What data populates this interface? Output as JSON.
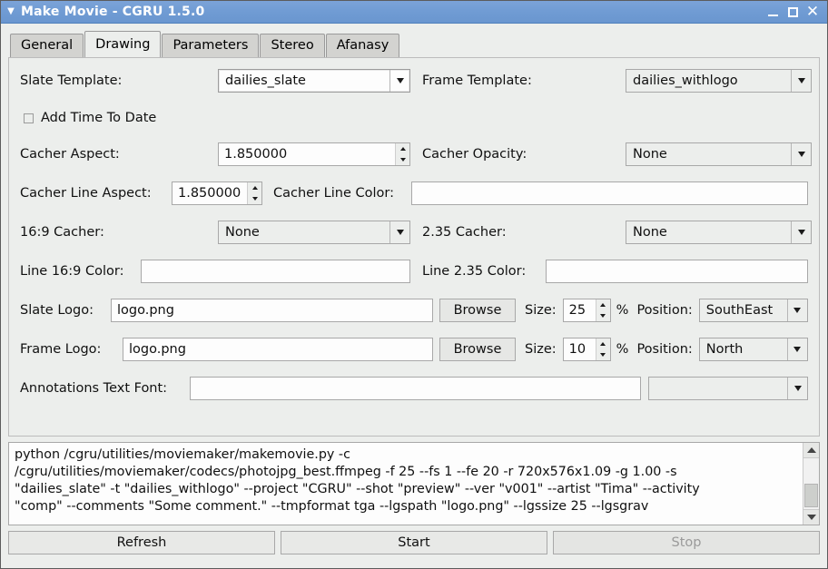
{
  "window": {
    "title": "Make Movie - CGRU 1.5.0",
    "menu_icon": "caret-down-icon",
    "minimize_label": "–",
    "maximize_label": "□",
    "close_label": "✕"
  },
  "tabs": [
    {
      "label": "General",
      "active": false
    },
    {
      "label": "Drawing",
      "active": true
    },
    {
      "label": "Parameters",
      "active": false
    },
    {
      "label": "Stereo",
      "active": false
    },
    {
      "label": "Afanasy",
      "active": false
    }
  ],
  "form": {
    "slate_template": {
      "label": "Slate Template:",
      "value": "dailies_slate"
    },
    "frame_template": {
      "label": "Frame Template:",
      "value": "dailies_withlogo"
    },
    "add_time_to_date": {
      "label": "Add Time To Date",
      "checked": false
    },
    "cacher_aspect": {
      "label": "Cacher Aspect:",
      "value": "1.850000"
    },
    "cacher_opacity": {
      "label": "Cacher Opacity:",
      "value": "None"
    },
    "cacher_line_aspect": {
      "label": "Cacher Line Aspect:",
      "value": "1.850000"
    },
    "cacher_line_color": {
      "label": "Cacher Line Color:",
      "value": ""
    },
    "cacher_169": {
      "label": "16:9 Cacher:",
      "value": "None"
    },
    "cacher_235": {
      "label": "2.35 Cacher:",
      "value": "None"
    },
    "line_169_color": {
      "label": "Line 16:9 Color:",
      "value": ""
    },
    "line_235_color": {
      "label": "Line 2.35 Color:",
      "value": ""
    },
    "slate_logo": {
      "label": "Slate Logo:",
      "value": "logo.png",
      "browse_label": "Browse",
      "size_label": "Size:",
      "size_value": "25",
      "percent_label": "%",
      "position_label": "Position:",
      "position_value": "SouthEast"
    },
    "frame_logo": {
      "label": "Frame Logo:",
      "value": "logo.png",
      "browse_label": "Browse",
      "size_label": "Size:",
      "size_value": "10",
      "percent_label": "%",
      "position_label": "Position:",
      "position_value": "North"
    },
    "annotations_text_font": {
      "label": "Annotations Text Font:",
      "value": "",
      "preset_value": ""
    }
  },
  "console": {
    "lines": [
      "python /cgru/utilities/moviemaker/makemovie.py -c",
      "/cgru/utilities/moviemaker/codecs/photojpg_best.ffmpeg -f 25 --fs 1  --fe 20  -r 720x576x1.09 -g 1.00 -s",
      "\"dailies_slate\" -t \"dailies_withlogo\" --project \"CGRU\" --shot \"preview\" --ver \"v001\" --artist \"Tima\" --activity",
      "\"comp\" --comments \"Some comment.\" --tmpformat tga --lgspath \"logo.png\" --lgssize 25 --lgsgrav"
    ]
  },
  "actions": {
    "refresh_label": "Refresh",
    "start_label": "Start",
    "stop_label": "Stop",
    "stop_disabled": true
  }
}
